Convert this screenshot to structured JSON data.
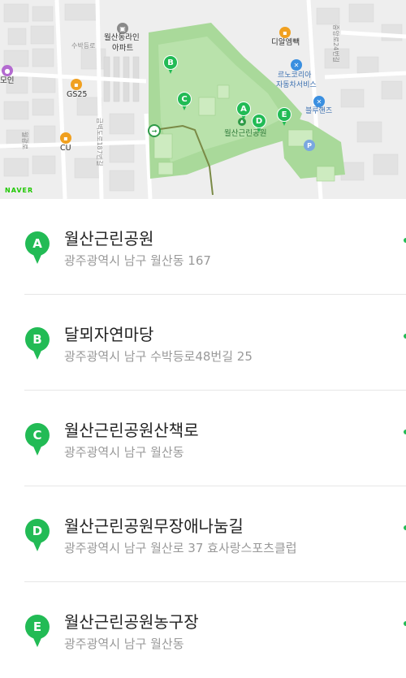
{
  "colors": {
    "accent": "#22bb55",
    "park": "#a9d99a",
    "text_primary": "#222222",
    "text_secondary": "#999999"
  },
  "map": {
    "labels": {
      "apartment_line1": "월산동라인",
      "apartment_line2": "아파트",
      "road_subak": "수박등로",
      "gs25": "GS25",
      "cu": "CU",
      "moin": "모인",
      "daiso": "디알엠빽",
      "renault_line1": "르노코리아",
      "renault_line2": "자동차서비스",
      "bluehands": "블루핸즈",
      "park_name": "월산근린공원",
      "road_vertical": "금벽도로187번길",
      "road_left": "월광로",
      "road_right": "중앙로24번길"
    },
    "pins": [
      "A",
      "B",
      "C",
      "D",
      "E"
    ],
    "logo": "NAVER"
  },
  "results": [
    {
      "letter": "A",
      "name": "월산근린공원",
      "address": "광주광역시 남구 월산동 167"
    },
    {
      "letter": "B",
      "name": "달뫼자연마당",
      "address": "광주광역시 남구 수박등로48번길 25"
    },
    {
      "letter": "C",
      "name": "월산근린공원산책로",
      "address": "광주광역시 남구 월산동"
    },
    {
      "letter": "D",
      "name": "월산근린공원무장애나눔길",
      "address": "광주광역시 남구 월산로 37 효사랑스포츠클럽"
    },
    {
      "letter": "E",
      "name": "월산근린공원농구장",
      "address": "광주광역시 남구 월산동"
    }
  ]
}
